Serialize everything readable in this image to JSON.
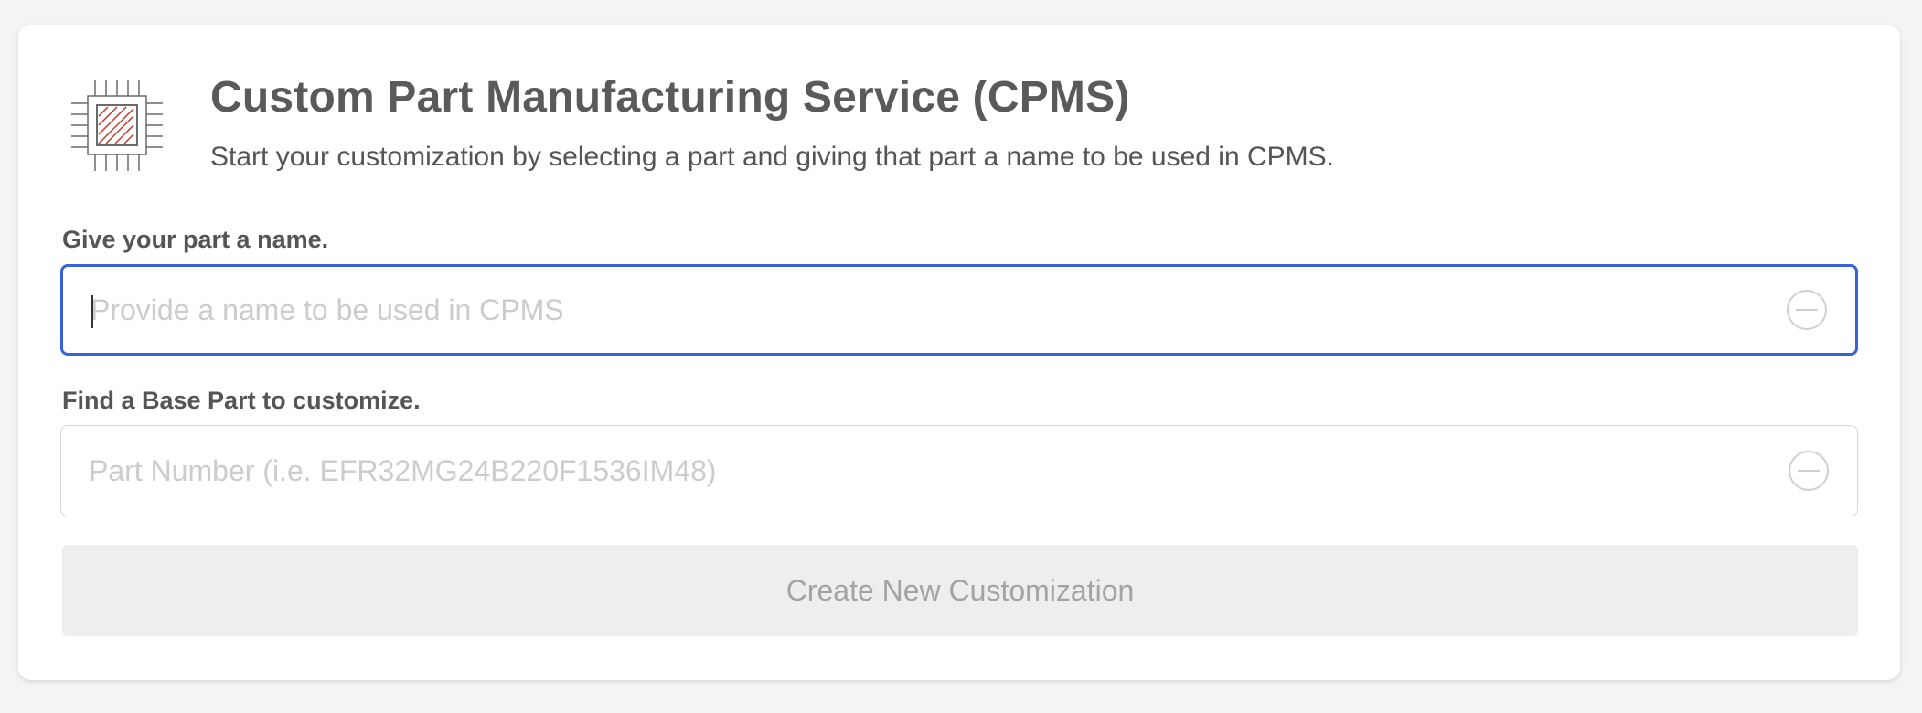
{
  "header": {
    "icon": "microchip-icon",
    "title": "Custom Part Manufacturing Service (CPMS)",
    "subtitle": "Start your customization by selecting a part and giving that part a name to be used in CPMS."
  },
  "name_field": {
    "label": "Give your part a name.",
    "value": "",
    "placeholder": "Provide a name to be used in CPMS",
    "clear_icon": "circle-minus-icon"
  },
  "base_part_field": {
    "label": "Find a Base Part to customize.",
    "value": "",
    "placeholder": "Part Number (i.e. EFR32MG24B220F1536IM48)",
    "clear_icon": "circle-minus-icon"
  },
  "create_button": {
    "label": "Create New Customization",
    "disabled": true
  },
  "colors": {
    "focus_border": "#3862dc",
    "chip_accent": "#c0392b",
    "text": "#555555",
    "placeholder": "#cccccc",
    "button_bg": "#eeeeee",
    "button_text": "#a3a3a3"
  }
}
